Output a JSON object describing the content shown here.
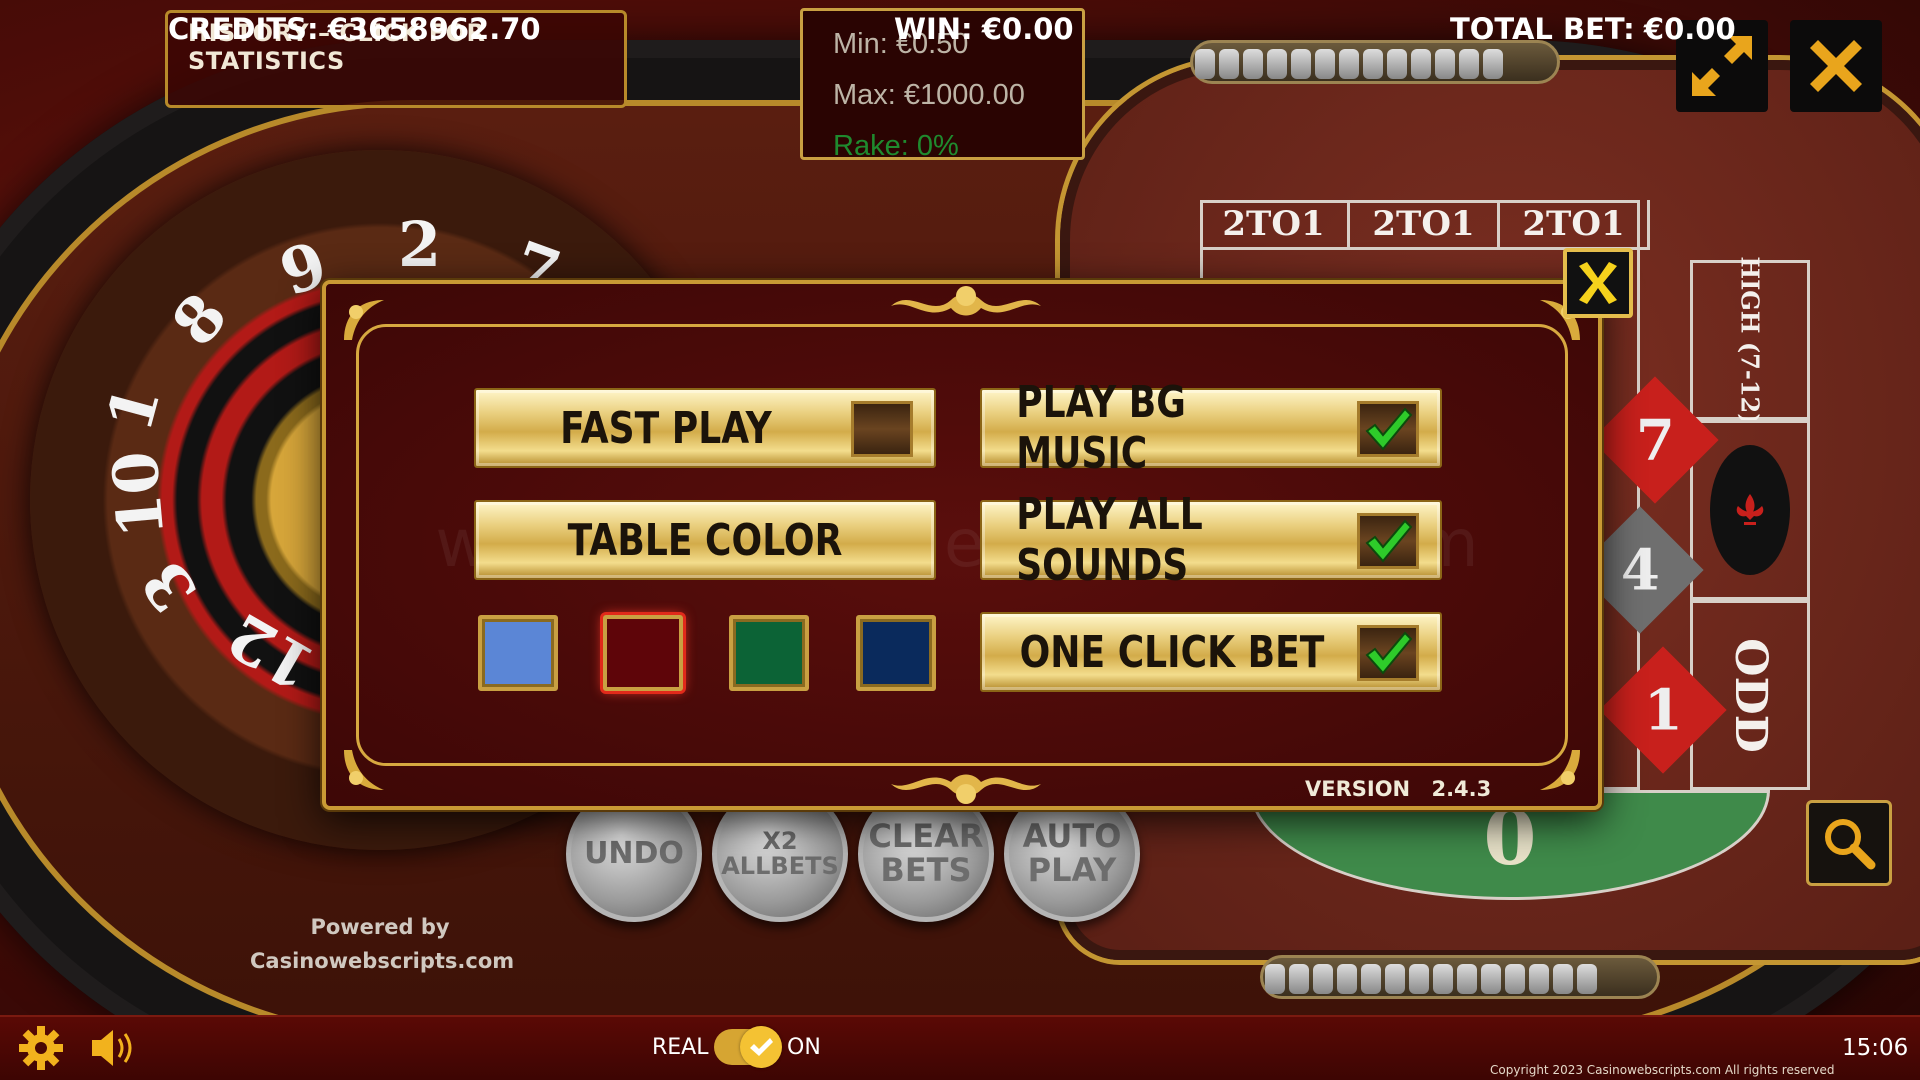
{
  "history": {
    "title": "HISTORY – CLICK FOR STATISTICS"
  },
  "limits": {
    "min": "Min: €0.50",
    "max": "Max: €1000.00",
    "rake": "Rake: 0%"
  },
  "table": {
    "column_heads": [
      "2TO1",
      "2TO1",
      "2TO1"
    ],
    "high_label": "HIGH (7-12)",
    "odd_label": "ODD",
    "numbers": [
      "7",
      "4",
      "1"
    ],
    "zero": "0",
    "wheel_numbers": [
      "9",
      "2",
      "7",
      "8",
      "1",
      "10",
      "3",
      "12"
    ]
  },
  "actions": {
    "undo": "UNDO",
    "x2_line1": "X2",
    "x2_line2": "ALLBETS",
    "clear_line1": "CLEAR",
    "clear_line2": "BETS",
    "auto_line1": "AUTO",
    "auto_line2": "PLAY"
  },
  "powered": {
    "line1": "Powered by",
    "line2": "Casinowebscripts.com"
  },
  "watermark": "www.casinowebscripts.com",
  "settings": {
    "fast_play": {
      "label": "FAST PLAY",
      "checked": false
    },
    "table_color": {
      "label": "TABLE COLOR"
    },
    "bg_music": {
      "label": "PLAY BG MUSIC",
      "checked": true
    },
    "all_sounds": {
      "label": "PLAY ALL SOUNDS",
      "checked": true
    },
    "one_click": {
      "label": "ONE CLICK BET",
      "checked": true
    },
    "swatches": [
      {
        "name": "blue",
        "color": "#5b86d6"
      },
      {
        "name": "red",
        "color": "#5e0509",
        "selected": true
      },
      {
        "name": "green",
        "color": "#0c6336"
      },
      {
        "name": "navy",
        "color": "#0a2a5c"
      }
    ],
    "version_label": "VERSION",
    "version": "2.4.3"
  },
  "bottom_bar": {
    "credits_label": "CREDITS:",
    "credits": "€3658962.70",
    "real_label": "REAL",
    "on_label": "ON",
    "win_label": "WIN:",
    "win": "€0.00",
    "total_bet_label": "TOTAL BET:",
    "total_bet": "€0.00",
    "time": "15:06",
    "copyright": "Copyright 2023 Casinowebscripts.com All rights reserved"
  },
  "colors": {
    "accent_gold": "#c99a34",
    "check_green": "#2ecb2a",
    "diamond_red": "#c8201c",
    "diamond_gray": "#6f6f6f"
  },
  "icons": [
    "settings-gear-icon",
    "sound-speaker-icon",
    "fullscreen-arrows-icon",
    "close-x-icon",
    "magnifier-icon",
    "checkmark-icon",
    "fleur-de-lis-icon"
  ]
}
